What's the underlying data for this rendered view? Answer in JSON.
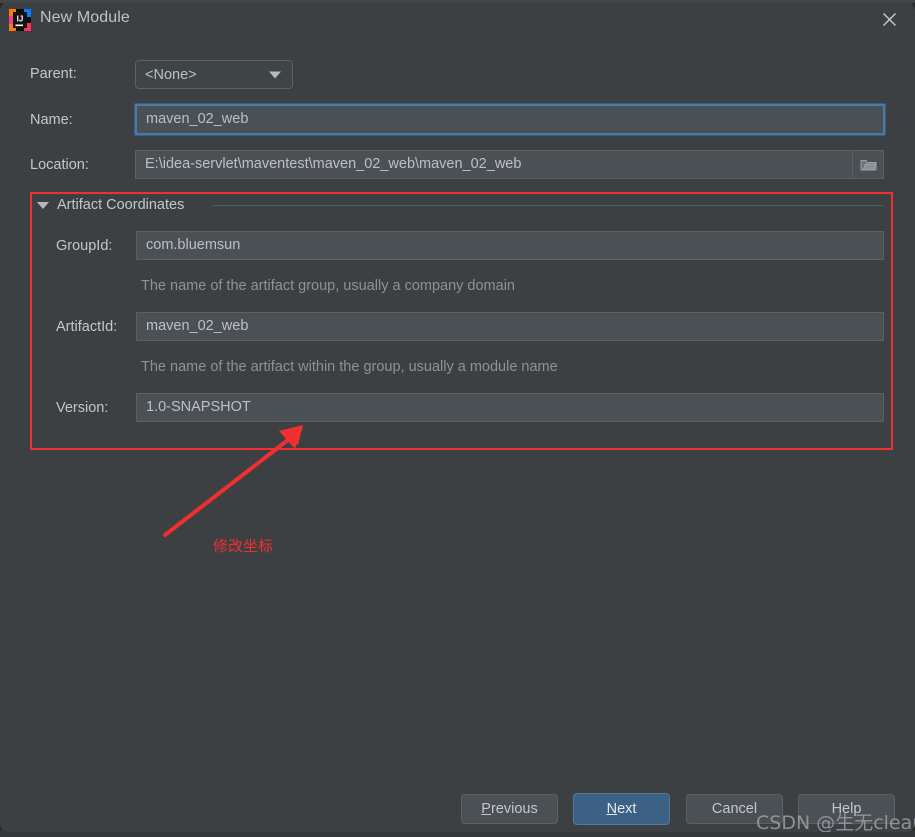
{
  "window": {
    "title": "New Module",
    "app_icon": "intellij-idea-icon",
    "close_icon": "close-icon"
  },
  "form": {
    "parent": {
      "label": "Parent:",
      "value": "<None>",
      "dropdown_icon": "chevron-down-icon"
    },
    "name": {
      "label": "Name:",
      "value": "maven_02_web",
      "focused": true
    },
    "location": {
      "label": "Location:",
      "value": "E:\\idea-servlet\\maventest\\maven_02_web\\maven_02_web",
      "browse_icon": "folder-icon"
    }
  },
  "artifact_coordinates": {
    "section_title": "Artifact Coordinates",
    "collapse_icon": "triangle-down-icon",
    "fields": [
      {
        "label": "GroupId:",
        "value": "com.bluemsun",
        "hint": "The name of the artifact group, usually a company domain"
      },
      {
        "label": "ArtifactId:",
        "value": "maven_02_web",
        "hint": "The name of the artifact within the group, usually a module name"
      },
      {
        "label": "Version:",
        "value": "1.0-SNAPSHOT",
        "hint": ""
      }
    ]
  },
  "annotation": {
    "text": "修改坐标",
    "color": "#f03030",
    "arrow_icon": "arrow-up-icon"
  },
  "buttons": {
    "previous": {
      "label": "Previous",
      "mnemonic": "P"
    },
    "next": {
      "label": "Next",
      "mnemonic": "N",
      "primary": true
    },
    "cancel": {
      "label": "Cancel"
    },
    "help": {
      "label": "Help"
    }
  },
  "watermark": {
    "text": "CSDN @生无clean"
  },
  "colors": {
    "dialog_bg": "#3c4043",
    "field_bg": "#4b5054",
    "accent_blue": "#3d6185",
    "focus_blue": "#4a7aa8",
    "annotation_red": "#f03030",
    "text_primary": "#c3c7cb",
    "text_hint": "#8d9296"
  }
}
